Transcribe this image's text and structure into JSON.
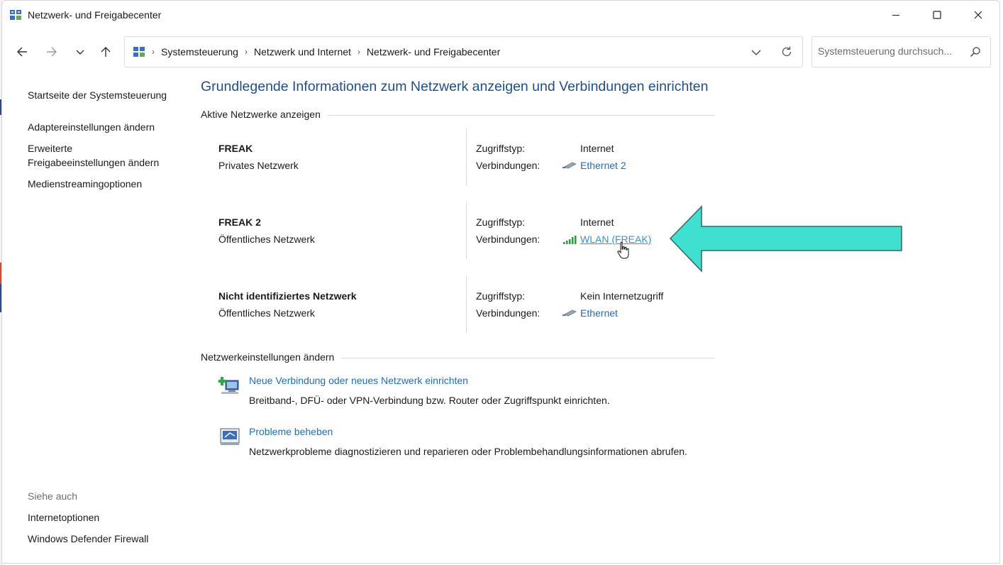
{
  "window": {
    "title": "Netzwerk- und Freigabecenter"
  },
  "address_bar": {
    "breadcrumbs": [
      "Systemsteuerung",
      "Netzwerk und Internet",
      "Netzwerk- und Freigabecenter"
    ]
  },
  "search": {
    "placeholder": "Systemsteuerung durchsuch..."
  },
  "sidebar": {
    "home": "Startseite der Systemsteuerung",
    "adapter": "Adaptereinstellungen ändern",
    "advanced_line1": "Erweiterte",
    "advanced_line2": "Freigabeeinstellungen ändern",
    "media": "Medienstreamingoptionen",
    "see_also": "Siehe auch",
    "internet_options": "Internetoptionen",
    "firewall": "Windows Defender Firewall"
  },
  "main": {
    "title": "Grundlegende Informationen zum Netzwerk anzeigen und Verbindungen einrichten",
    "active_networks_heading": "Aktive Netzwerke anzeigen",
    "access_label": "Zugriffstyp:",
    "connections_label": "Verbindungen:",
    "networks": [
      {
        "name": "FREAK",
        "type": "Privates Netzwerk",
        "access": "Internet",
        "connection": "Ethernet 2",
        "connection_icon": "ethernet-icon"
      },
      {
        "name": "FREAK 2",
        "type": "Öffentliches Netzwerk",
        "access": "Internet",
        "connection": "WLAN (FREAK)",
        "connection_icon": "wifi-signal-icon"
      },
      {
        "name": "Nicht identifiziertes Netzwerk",
        "type": "Öffentliches Netzwerk",
        "access": "Kein Internetzugriff",
        "connection": "Ethernet",
        "connection_icon": "ethernet-icon"
      }
    ],
    "settings_heading": "Netzwerkeinstellungen ändern",
    "tasks": [
      {
        "link": "Neue Verbindung oder neues Netzwerk einrichten",
        "desc": "Breitband-, DFÜ- oder VPN-Verbindung bzw. Router oder Zugriffspunkt einrichten.",
        "icon": "new-connection-icon"
      },
      {
        "link": "Probleme beheben",
        "desc": "Netzwerkprobleme diagnostizieren und reparieren oder Problembehandlungsinformationen abrufen.",
        "icon": "troubleshoot-icon"
      }
    ]
  },
  "colors": {
    "link": "#1e6eb8",
    "title": "#1e4e8c",
    "arrow": "#40e0d0"
  }
}
